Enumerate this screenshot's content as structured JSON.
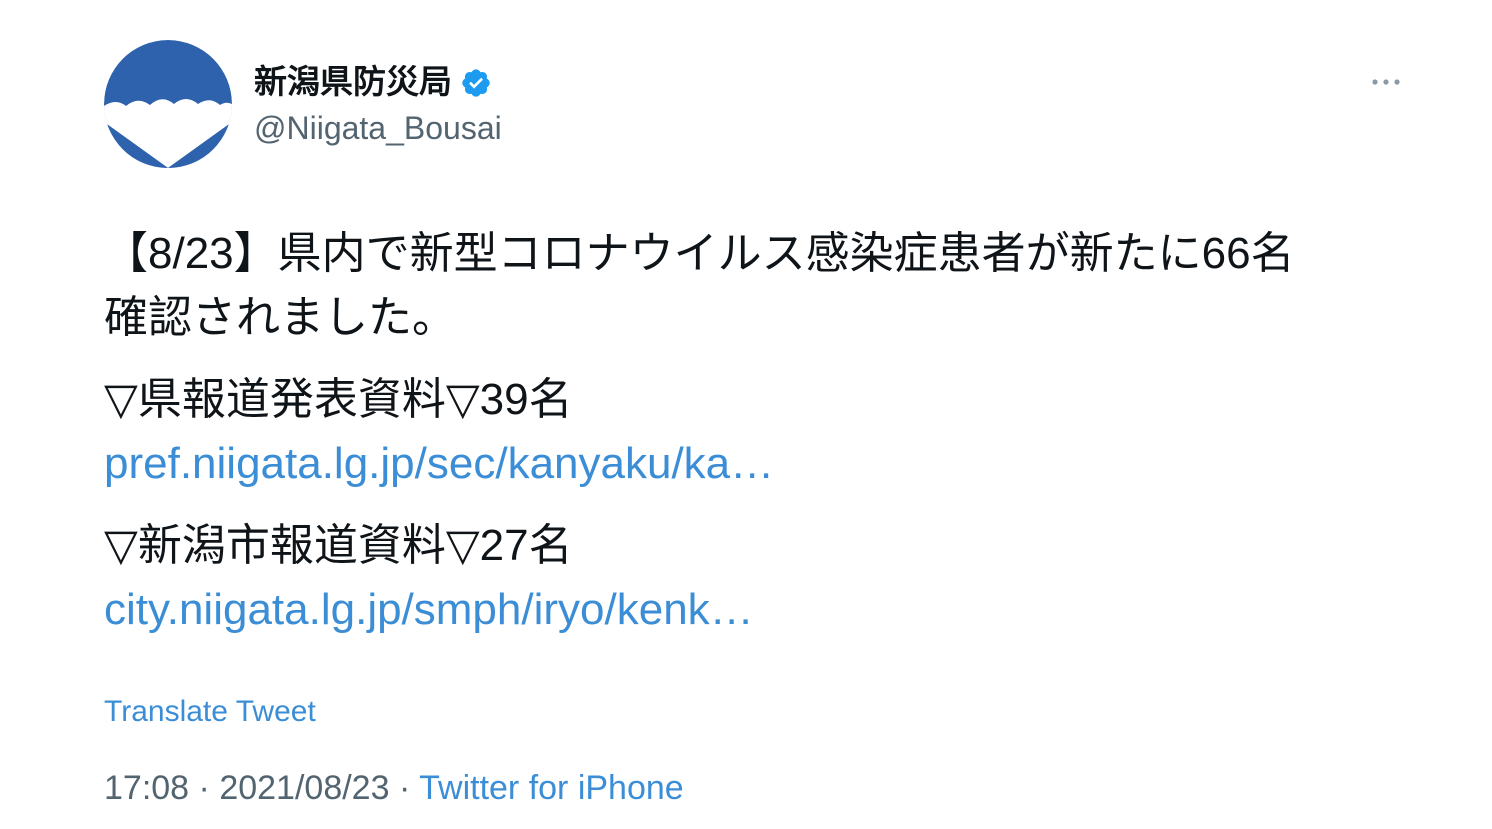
{
  "user": {
    "display_name": "新潟県防災局",
    "handle": "@Niigata_Bousai",
    "verified": true,
    "avatar_icon": "niigata-logo-icon"
  },
  "more_icon": "ellipsis-icon",
  "tweet": {
    "line1": "【8/23】県内で新型コロナウイルス感染症患者が新たに66名",
    "line2": "確認されました。",
    "pref_label": "▽県報道発表資料▽39名",
    "pref_link": "pref.niigata.lg.jp/sec/kanyaku/ka…",
    "city_label": "▽新潟市報道資料▽27名",
    "city_link": "city.niigata.lg.jp/smph/iryo/kenk…"
  },
  "translate_label": "Translate Tweet",
  "meta": {
    "time": "17:08",
    "separator": "·",
    "date": "2021/08/23",
    "source": "Twitter for iPhone"
  },
  "colors": {
    "avatar_blue": "#2e62ad",
    "verified_blue": "#1d9bf0",
    "link_blue": "#3b8dd6",
    "secondary_text": "#536471"
  }
}
